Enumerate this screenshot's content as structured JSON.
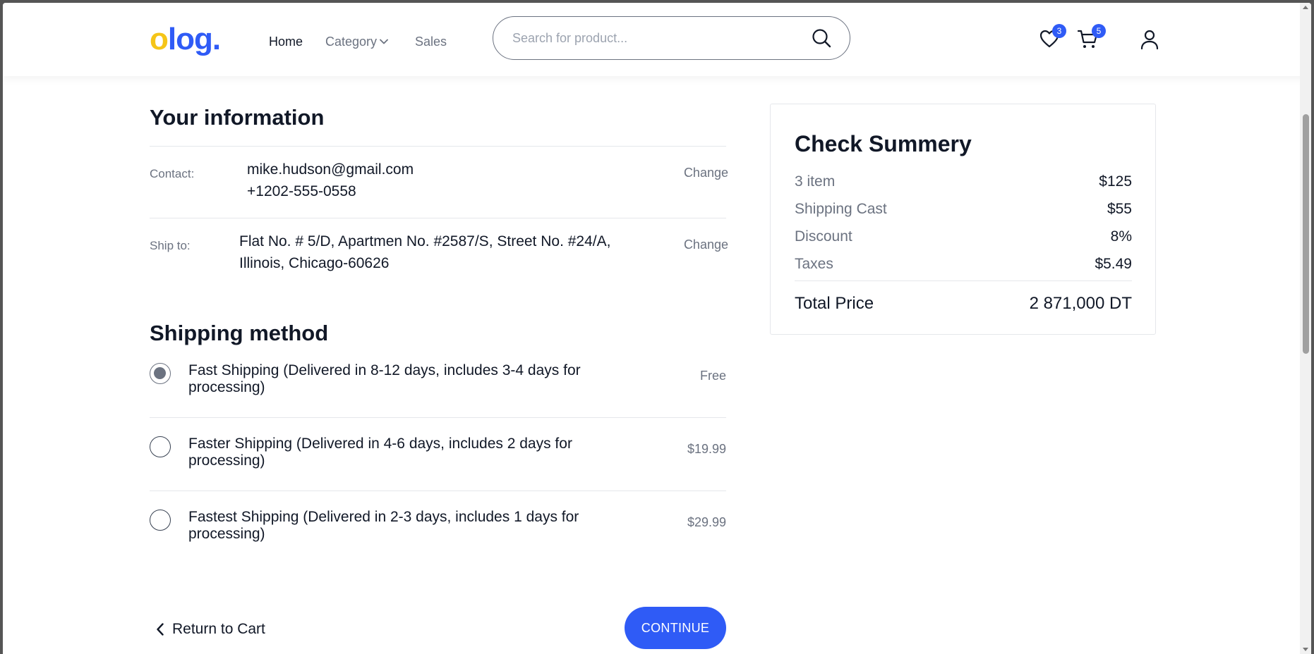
{
  "header": {
    "logo_first": "o",
    "logo_rest": "log.",
    "nav": {
      "home": "Home",
      "category": "Category",
      "sales": "Sales"
    },
    "search_placeholder": "Search for product...",
    "wishlist_count": "3",
    "cart_count": "5",
    "icons": [
      "search-icon",
      "heart-icon",
      "cart-icon",
      "user-icon",
      "chevron-down-icon"
    ]
  },
  "info": {
    "title": "Your information",
    "contact_label": "Contact:",
    "email": "mike.hudson@gmail.com",
    "phone": "+1202-555-0558",
    "ship_label": "Ship to:",
    "address_line1": "Flat No. # 5/D, Apartmen No. #2587/S, Street No. #24/A,",
    "address_line2": "Illinois, Chicago-60626",
    "change": "Change"
  },
  "shipping": {
    "title": "Shipping method",
    "options": [
      {
        "line1": "Fast Shipping (Delivered in 8-12 days, includes 3-4 days for",
        "line2": "processing)",
        "price": "Free",
        "selected": true
      },
      {
        "line1": "Faster Shipping (Delivered in 4-6 days, includes 2 days for",
        "line2": "processing)",
        "price": "$19.99",
        "selected": false
      },
      {
        "line1": "Fastest Shipping (Delivered in 2-3 days, includes 1 days for",
        "line2": "processing)",
        "price": "$29.99",
        "selected": false
      }
    ]
  },
  "actions": {
    "back": "Return to Cart",
    "continue": "CONTINUE"
  },
  "summary": {
    "title": "Check Summery",
    "rows": [
      {
        "label": "3 item",
        "value": "$125"
      },
      {
        "label": "Shipping Cast",
        "value": "$55"
      },
      {
        "label": "Discount",
        "value": "8%"
      },
      {
        "label": "Taxes",
        "value": "$5.49"
      }
    ],
    "total_label": "Total Price",
    "total_value": "2 871,000 DT"
  },
  "colors": {
    "accent": "#2f5bf6",
    "logo_yellow": "#f5c518",
    "muted": "#6b7280"
  }
}
